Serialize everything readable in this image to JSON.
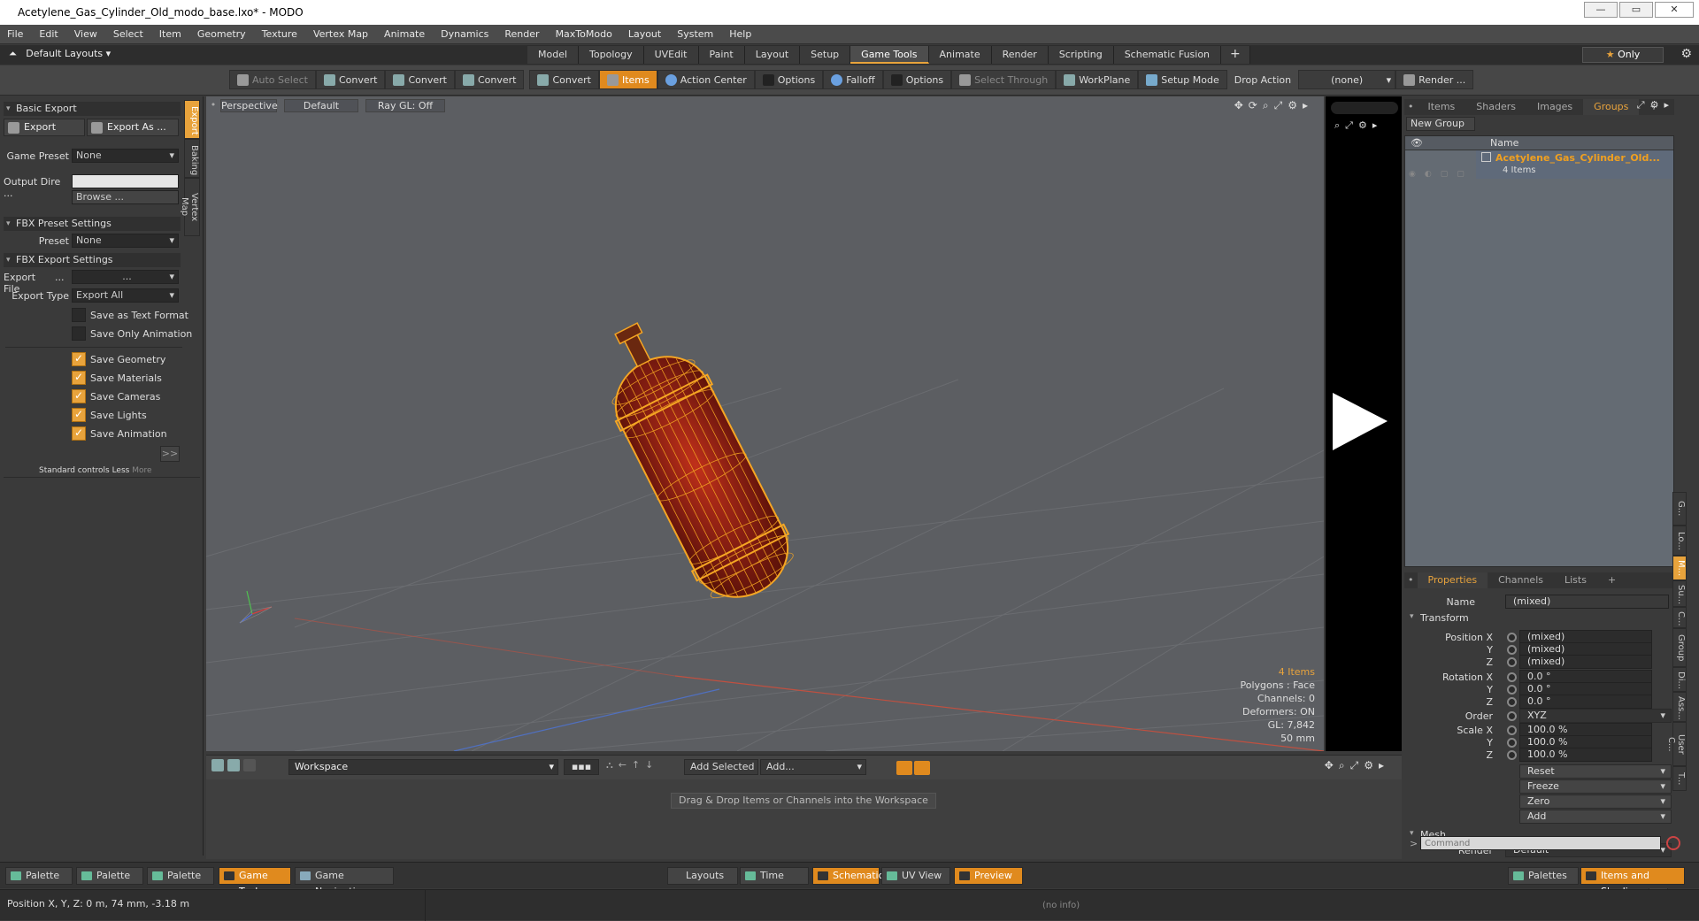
{
  "window": {
    "title": "Acetylene_Gas_Cylinder_Old_modo_base.lxo* - MODO"
  },
  "menu": [
    "File",
    "Edit",
    "View",
    "Select",
    "Item",
    "Geometry",
    "Texture",
    "Vertex Map",
    "Animate",
    "Dynamics",
    "Render",
    "MaxToModo",
    "Layout",
    "System",
    "Help"
  ],
  "layout": {
    "selector": "Default Layouts",
    "tabs": [
      "Model",
      "Topology",
      "UVEdit",
      "Paint",
      "Layout",
      "Setup",
      "Game Tools",
      "Animate",
      "Render",
      "Scripting",
      "Schematic Fusion"
    ],
    "active_tab": "Game Tools",
    "only_label": "Only"
  },
  "toolbar": {
    "auto_select": "Auto Select",
    "convert1": "Convert",
    "convert2": "Convert",
    "convert3": "Convert",
    "convert4": "Convert",
    "items": "Items",
    "action_center": "Action Center",
    "options1": "Options",
    "falloff": "Falloff",
    "options2": "Options",
    "select_through": "Select Through",
    "workplane": "WorkPlane",
    "setup_mode": "Setup Mode",
    "drop_action": "Drop Action",
    "drop_value": "(none)",
    "render": "Render ..."
  },
  "left": {
    "basic_export": "Basic Export",
    "export_btn": "Export",
    "export_as_btn": "Export As ...",
    "game_preset_label": "Game Preset",
    "game_preset_value": "None",
    "output_dir_label": "Output Dire ...",
    "output_dir_value": "",
    "browse": "Browse ...",
    "fbx_preset_settings": "FBX Preset Settings",
    "preset_label": "Preset",
    "preset_value": "None",
    "fbx_export_settings": "FBX Export Settings",
    "export_file_label": "Export File",
    "export_file_dots": "...",
    "export_file_value": "...",
    "export_type_label": "Export Type",
    "export_type_value": "Export All",
    "checks": [
      {
        "label": "Save as Text Format"
      },
      {
        "label": "Save Only Animation"
      },
      {
        "label": "Save Geometry"
      },
      {
        "label": "Save Materials"
      },
      {
        "label": "Save Cameras"
      },
      {
        "label": "Save Lights"
      },
      {
        "label": "Save Animation"
      }
    ],
    "more_arrow": ">>",
    "std_controls": "Standard controls",
    "less": "Less",
    "more": "More",
    "vtabs": [
      "Export",
      "Baking",
      "Vertex Map"
    ]
  },
  "viewport": {
    "view": "Perspective",
    "shading": "Default",
    "raygl": "Ray GL: Off",
    "info": {
      "items": "4 Items",
      "polygons": "Polygons : Face",
      "channels": "Channels: 0",
      "deformers": "Deformers: ON",
      "gl": "GL: 7,842",
      "scale": "50 mm"
    }
  },
  "workspace": {
    "name": "Workspace",
    "add_selected": "Add Selected",
    "add": "Add...",
    "drop_msg": "Drag & Drop Items or Channels into the Workspace"
  },
  "groups": {
    "tabs": [
      "Items",
      "Shaders",
      "Images",
      "Groups"
    ],
    "active": "Groups",
    "new_group": "New Group",
    "col_name": "Name",
    "item_name": "Acetylene_Gas_Cylinder_Old...",
    "item_count": "4 Items"
  },
  "props": {
    "tabs": [
      "Properties",
      "Channels",
      "Lists"
    ],
    "active": "Properties",
    "name_label": "Name",
    "name_value": "(mixed)",
    "transform": "Transform",
    "position_label": "Position X",
    "pos": [
      "(mixed)",
      "(mixed)",
      "(mixed)"
    ],
    "rotation_label": "Rotation X",
    "rot": [
      "0.0 °",
      "0.0 °",
      "0.0 °"
    ],
    "order_label": "Order",
    "order_value": "XYZ",
    "scale_label": "Scale X",
    "scale": [
      "100.0 %",
      "100.0 %",
      "100.0 %"
    ],
    "y": "Y",
    "z": "Z",
    "reset": "Reset",
    "freeze": "Freeze",
    "zero": "Zero",
    "add": "Add",
    "mesh": "Mesh",
    "render_label": "Render",
    "render_value": "Default",
    "more_arrow": ">>",
    "command_placeholder": "Command",
    "vtabs": [
      "G...",
      "Lo...",
      "M...",
      "Su...",
      "C...",
      "Group",
      "Di...",
      "Ass...",
      "User C...",
      "T..."
    ]
  },
  "bottom": {
    "palette1": "Palette",
    "palette2": "Palette",
    "palette3": "Palette",
    "game_tools": "Game Tools",
    "game_navigation": "Game Navigation",
    "layouts": "Layouts",
    "time": "Time",
    "schematic": "Schematic",
    "uv_view": "UV View",
    "preview": "Preview",
    "palettes": "Palettes",
    "items_shading": "Items and Shading"
  },
  "status": {
    "position": "Position X, Y, Z:  0 m, 74 mm, -3.18 m",
    "info": "(no info)"
  },
  "colors": {
    "accent": "#e8a33c",
    "viewport_bg": "#5c5e62",
    "wire": "#f0a020"
  }
}
